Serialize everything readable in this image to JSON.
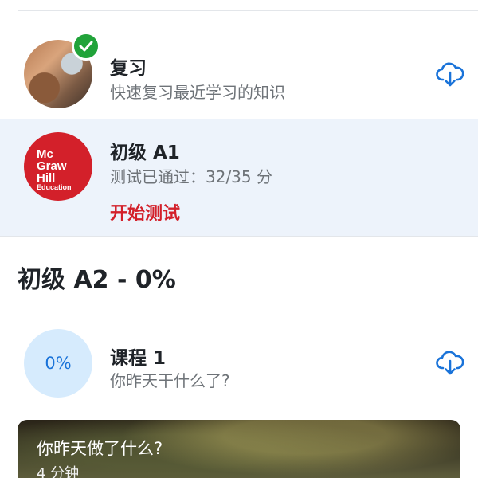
{
  "review": {
    "title": "复习",
    "subtitle": "快速复习最近学习的知识"
  },
  "level_a1": {
    "logo_lines": [
      "Mc",
      "Graw",
      "Hill",
      "Education"
    ],
    "title": "初级 A1",
    "status": "测试已通过：32/35 分",
    "action": "开始测试"
  },
  "section": {
    "title": "初级 A2 - 0%"
  },
  "lesson": {
    "progress": "0%",
    "title": "课程 1",
    "subtitle": "你昨天干什么了?"
  },
  "video": {
    "title": "你昨天做了什么?",
    "duration": "4 分钟"
  },
  "colors": {
    "accent_blue": "#1a73d9",
    "brand_red": "#d3202a",
    "success_green": "#21a33a",
    "highlight_bg": "#edf3fb"
  },
  "icons": [
    "check-icon",
    "cloud-download-icon"
  ]
}
